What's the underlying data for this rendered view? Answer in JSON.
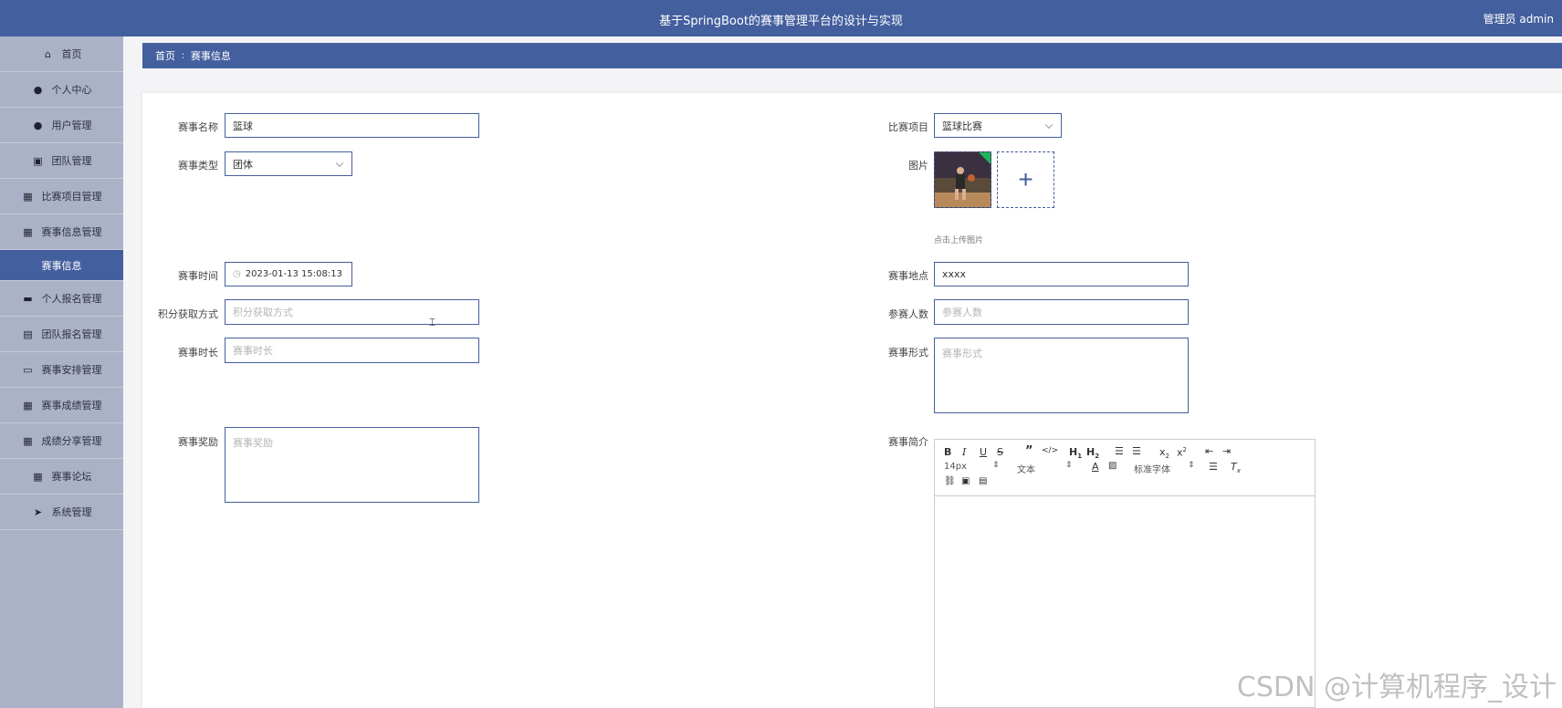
{
  "header": {
    "title": "基于SpringBoot的赛事管理平台的设计与实现",
    "user": "管理员 admin"
  },
  "sidebar": {
    "items": [
      {
        "label": "首页",
        "icon": "home-icon",
        "glyph": "⌂"
      },
      {
        "label": "个人中心",
        "icon": "person-icon",
        "glyph": "●"
      },
      {
        "label": "用户管理",
        "icon": "person-icon",
        "glyph": "●"
      },
      {
        "label": "团队管理",
        "icon": "chart-icon",
        "glyph": "▣"
      },
      {
        "label": "比赛项目管理",
        "icon": "grid-icon",
        "glyph": "▦"
      },
      {
        "label": "赛事信息管理",
        "icon": "grid-icon",
        "glyph": "▦"
      },
      {
        "label": "赛事信息",
        "icon": "",
        "glyph": "",
        "active": true
      },
      {
        "label": "个人报名管理",
        "icon": "comment-icon",
        "glyph": "▬"
      },
      {
        "label": "团队报名管理",
        "icon": "clipboard-icon",
        "glyph": "▤"
      },
      {
        "label": "赛事安排管理",
        "icon": "monitor-icon",
        "glyph": "▭"
      },
      {
        "label": "赛事成绩管理",
        "icon": "grid-icon",
        "glyph": "▦"
      },
      {
        "label": "成绩分享管理",
        "icon": "grid-icon",
        "glyph": "▦"
      },
      {
        "label": "赛事论坛",
        "icon": "grid-icon",
        "glyph": "▦"
      },
      {
        "label": "系统管理",
        "icon": "send-icon",
        "glyph": "➤"
      }
    ]
  },
  "breadcrumb": {
    "home": "首页",
    "separator": "∶",
    "current": "赛事信息"
  },
  "form": {
    "event_name": {
      "label": "赛事名称",
      "value": "篮球"
    },
    "project": {
      "label": "比赛项目",
      "value": "篮球比赛"
    },
    "event_type": {
      "label": "赛事类型",
      "value": "团体"
    },
    "image": {
      "label": "图片",
      "hint": "点击上传图片"
    },
    "event_time": {
      "label": "赛事时间",
      "value": "2023-01-13 15:08:13"
    },
    "location": {
      "label": "赛事地点",
      "value": "xxxx"
    },
    "points_method": {
      "label": "积分获取方式",
      "placeholder": "积分获取方式"
    },
    "participants": {
      "label": "参赛人数",
      "placeholder": "参赛人数"
    },
    "duration": {
      "label": "赛事时长",
      "placeholder": "赛事时长"
    },
    "format": {
      "label": "赛事形式",
      "placeholder": "赛事形式"
    },
    "reward": {
      "label": "赛事奖励",
      "placeholder": "赛事奖励"
    },
    "intro": {
      "label": "赛事简介"
    }
  },
  "editor": {
    "font_size": "14px",
    "text_type": "文本",
    "font_family": "标准字体"
  },
  "watermark": "CSDN @计算机程序_设计",
  "colors": {
    "primary": "#445f9e",
    "sidebar_bg": "#abb2c8"
  }
}
